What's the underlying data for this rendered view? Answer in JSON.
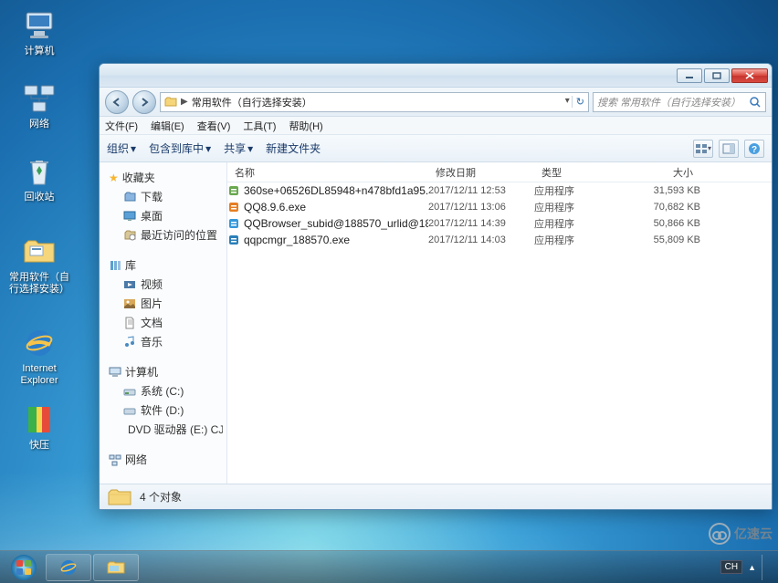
{
  "desktop": {
    "icons": [
      {
        "name": "computer",
        "label": "计算机"
      },
      {
        "name": "network",
        "label": "网络"
      },
      {
        "name": "recycle",
        "label": "回收站"
      },
      {
        "name": "folder-app",
        "label": "常用软件（自行选择安装）"
      },
      {
        "name": "ie",
        "label": "Internet Explorer"
      },
      {
        "name": "kuaiya",
        "label": "快压"
      }
    ]
  },
  "window": {
    "address_sep": "▶",
    "address": "常用软件（自行选择安装）",
    "search_placeholder": "搜索 常用软件（自行选择安装）",
    "menus": {
      "file": "文件(F)",
      "edit": "编辑(E)",
      "view": "查看(V)",
      "tools": "工具(T)",
      "help": "帮助(H)"
    },
    "toolbar": {
      "organize": "组织",
      "include": "包含到库中",
      "share": "共享",
      "newfolder": "新建文件夹"
    },
    "columns": {
      "name": "名称",
      "date": "修改日期",
      "type": "类型",
      "size": "大小"
    },
    "sidebar": {
      "favorites": {
        "head": "收藏夹",
        "items": [
          "下载",
          "桌面",
          "最近访问的位置"
        ]
      },
      "libraries": {
        "head": "库",
        "items": [
          "视频",
          "图片",
          "文档",
          "音乐"
        ]
      },
      "computer": {
        "head": "计算机",
        "items": [
          "系统 (C:)",
          "软件 (D:)",
          "DVD 驱动器 (E:) CJ."
        ]
      },
      "network": {
        "head": "网络"
      }
    },
    "files": [
      {
        "name": "360se+06526DL85948+n478bfd1a95...",
        "date": "2017/12/11 12:53",
        "type": "应用程序",
        "size": "31,593 KB"
      },
      {
        "name": "QQ8.9.6.exe",
        "date": "2017/12/11 13:06",
        "type": "应用程序",
        "size": "70,682 KB"
      },
      {
        "name": "QQBrowser_subid@188570_urlid@18...",
        "date": "2017/12/11 14:39",
        "type": "应用程序",
        "size": "50,866 KB"
      },
      {
        "name": "qqpcmgr_188570.exe",
        "date": "2017/12/11 14:03",
        "type": "应用程序",
        "size": "55,809 KB"
      }
    ],
    "status": "4 个对象"
  },
  "taskbar": {
    "lang": "CH"
  },
  "watermark": "亿速云"
}
